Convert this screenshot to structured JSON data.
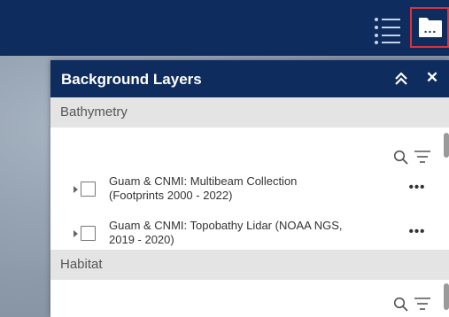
{
  "toolbar": {
    "layer_list_icon": "list-icon",
    "folder_icon": "folder-icon",
    "folder_dots": "...",
    "accent_color": "#0e2c5e",
    "highlight_color": "#d9333f"
  },
  "panel": {
    "title": "Background Layers",
    "collapse_icon": "double-chevron-up-icon",
    "close_label": "✕",
    "sections": [
      {
        "title": "Bathymetry",
        "layers": [
          {
            "line1": "Guam & CNMI: Multibeam Collection",
            "line2": "(Footprints 2000 - 2022)",
            "menu": "•••"
          },
          {
            "line1": "Guam & CNMI: Topobathy Lidar (NOAA NGS,",
            "line2": "2019 - 2020)",
            "menu": "•••"
          }
        ]
      },
      {
        "title": "Habitat",
        "layers": []
      }
    ]
  }
}
